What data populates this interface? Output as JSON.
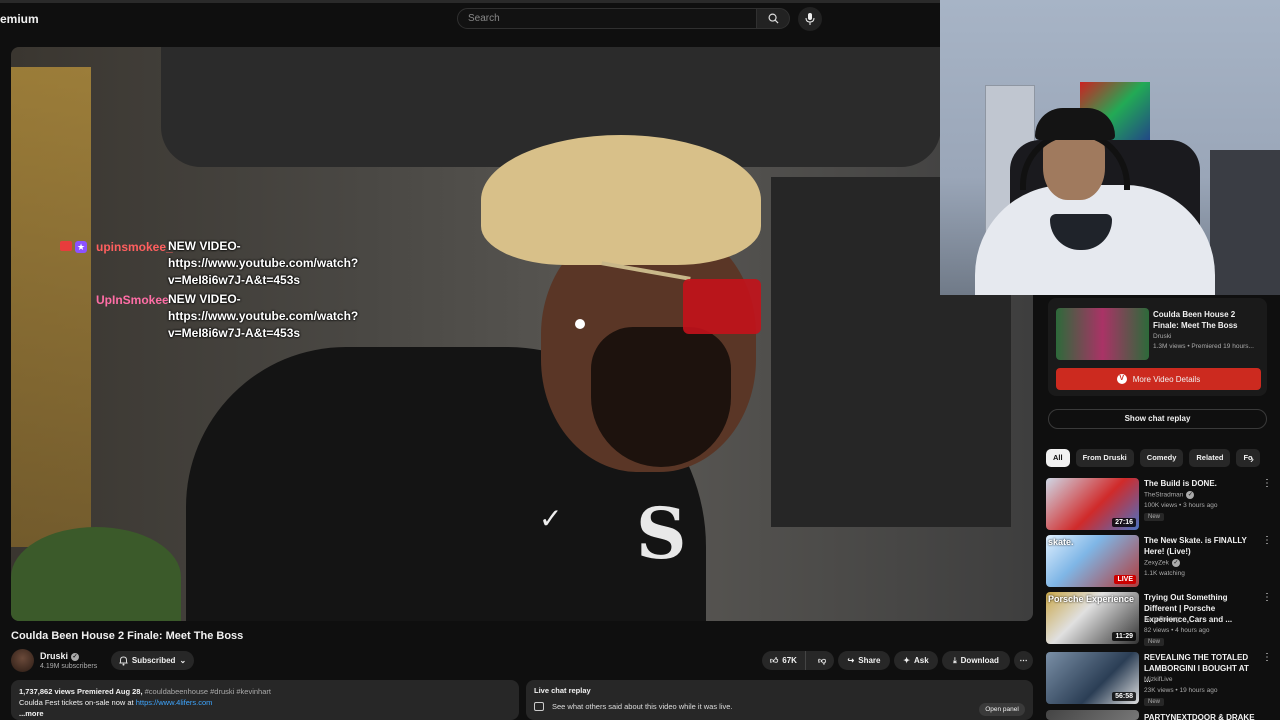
{
  "header": {
    "brand": "emium",
    "search_placeholder": "Search"
  },
  "chat_overlay": {
    "messages": [
      {
        "author": "upinsmokee_",
        "text": "NEW VIDEO-https://www.youtube.com/watch?v=MeI8i6w7J-A&t=453s"
      },
      {
        "author": "UpInSmokee",
        "text": "NEW VIDEO-https://www.youtube.com/watch?v=MeI8i6w7J-A&t=453s"
      }
    ]
  },
  "video": {
    "title": "Coulda Been House 2 Finale: Meet The Boss",
    "channel": "Druski",
    "subscribers": "4.19M subscribers",
    "subscribed_label": "Subscribed",
    "likes": "67K",
    "share_label": "Share",
    "ask_label": "Ask",
    "download_label": "Download"
  },
  "description": {
    "stats": "1,737,862 views  Premiered Aug 28,",
    "tags": "#couldabeenhouse #druski #kevinhart",
    "line2": "Coulda Fest tickets on-sale now at ",
    "link": "https://www.4lifers.com",
    "more": "...more"
  },
  "live_chat_box": {
    "title": "Live chat replay",
    "text": "See what others said about this video while it was live.",
    "open_panel": "Open panel"
  },
  "sidebar": {
    "mini_card": {
      "title": "Coulda Been House 2 Finale: Meet The Boss",
      "channel": "Druski",
      "meta": "1.3M views • Premiered 19 hours...",
      "button": "More Video Details"
    },
    "show_chat_replay": "Show chat replay",
    "chips": [
      "All",
      "From Druski",
      "Comedy",
      "Related",
      "Fo"
    ],
    "recommendations": [
      {
        "title": "The Build is DONE.",
        "channel": "TheStradman",
        "meta": "100K views • 3 hours ago",
        "badge": "New",
        "duration": "27:16",
        "live": ""
      },
      {
        "title": "The New Skate. is FINALLY Here! (Live!)",
        "channel": "ZexyZek",
        "meta": "1.1K watching",
        "badge": "",
        "duration": "",
        "live": "LIVE",
        "thumb_text": "skate."
      },
      {
        "title": "Trying Out Something Different | Porsche Experience,Cars and ...",
        "channel": "KanaRacing",
        "meta": "82 views • 4 hours ago",
        "badge": "New",
        "duration": "11:29",
        "live": "",
        "thumb_text": "Porsche Experience"
      },
      {
        "title": "REVEALING THE TOTALED LAMBORGINI I BOUGHT AT ...",
        "channel": "MizkifLive",
        "meta": "23K views • 19 hours ago",
        "badge": "New",
        "duration": "56:58",
        "live": ""
      },
      {
        "title": "PARTYNEXTDOOR & DRAKE -",
        "channel": "",
        "meta": "",
        "badge": "",
        "duration": "",
        "live": ""
      }
    ]
  },
  "colors": {
    "background": "#0f0f0f",
    "accent_red": "#cc2a1f",
    "chat_name": "#ff5f5f"
  }
}
